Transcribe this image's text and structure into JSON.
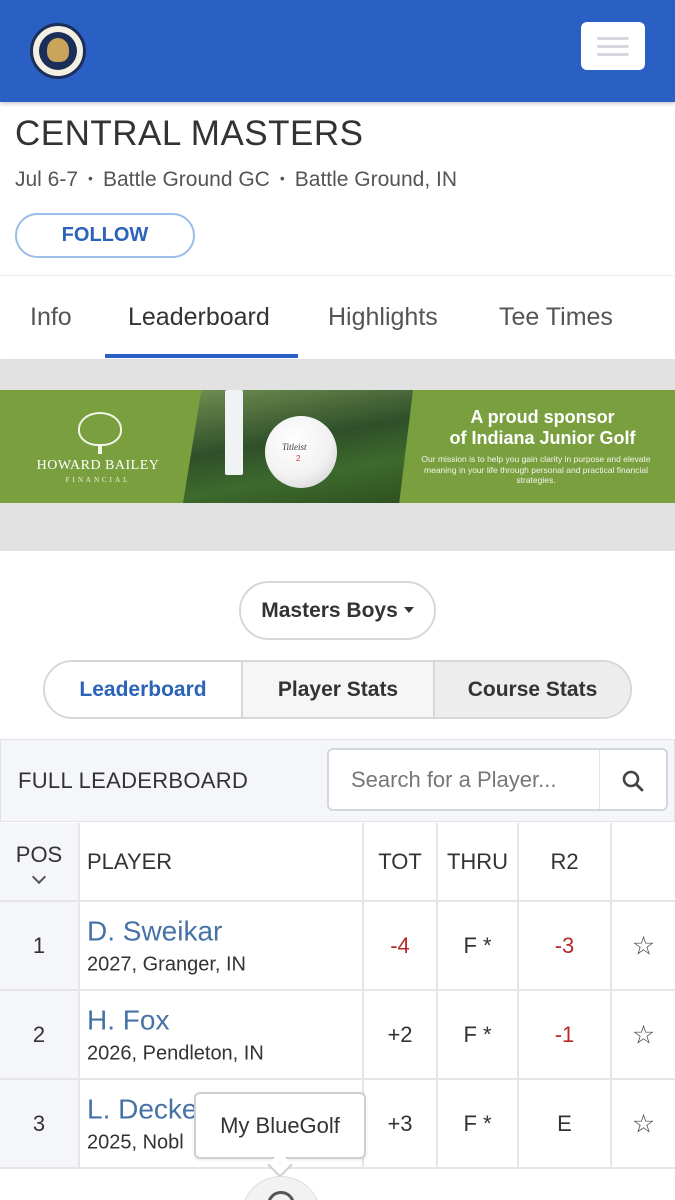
{
  "header": {
    "logo_alt": "Indiana Golf Foundation Since 1994",
    "menu_icon": "hamburger-icon"
  },
  "event": {
    "title": "CENTRAL MASTERS",
    "dates": "Jul 6-7",
    "separator": "•",
    "course": "Battle Ground GC",
    "location": "Battle Ground, IN",
    "follow_label": "FOLLOW"
  },
  "tabs": [
    {
      "label": "Info",
      "active": false
    },
    {
      "label": "Leaderboard",
      "active": true
    },
    {
      "label": "Highlights",
      "active": false
    },
    {
      "label": "Tee Times",
      "active": false
    }
  ],
  "ad": {
    "brand": "HOWARD BAILEY",
    "brand_sub": "FINANCIAL",
    "ball_brand": "Titleist",
    "ball_number": "2",
    "headline_1": "A proud sponsor",
    "headline_2": "of Indiana Junior Golf",
    "mission": "Our mission is to help you gain clarity in purpose and elevate meaning in your life through personal and practical financial strategies."
  },
  "division": {
    "selected": "Masters Boys"
  },
  "segments": [
    {
      "label": "Leaderboard",
      "active": true
    },
    {
      "label": "Player Stats",
      "active": false
    },
    {
      "label": "Course Stats",
      "active": false
    }
  ],
  "leaderboard": {
    "title": "FULL LEADERBOARD",
    "search_placeholder": "Search for a Player...",
    "columns": [
      "POS",
      "PLAYER",
      "TOT",
      "THRU",
      "R2",
      ""
    ],
    "rows": [
      {
        "pos": "1",
        "name": "D. Sweikar",
        "info": "2027, Granger, IN",
        "tot": "-4",
        "thru": "F *",
        "r2": "-3",
        "tot_under": true,
        "r2_under": true
      },
      {
        "pos": "2",
        "name": "H. Fox",
        "info": "2026, Pendleton, IN",
        "tot": "+2",
        "thru": "F *",
        "r2": "-1",
        "tot_under": false,
        "r2_under": true
      },
      {
        "pos": "3",
        "name": "L. Decke",
        "info": "2025, Nobl",
        "tot": "+3",
        "thru": "F *",
        "r2": "E",
        "tot_under": false,
        "r2_under": false
      }
    ]
  },
  "tooltip": {
    "label": "My BlueGolf"
  },
  "colors": {
    "brand_blue": "#2a5fc4",
    "link_blue": "#4672a5",
    "under_par_red": "#b52a2a",
    "ad_green": "#7a9f3f"
  }
}
